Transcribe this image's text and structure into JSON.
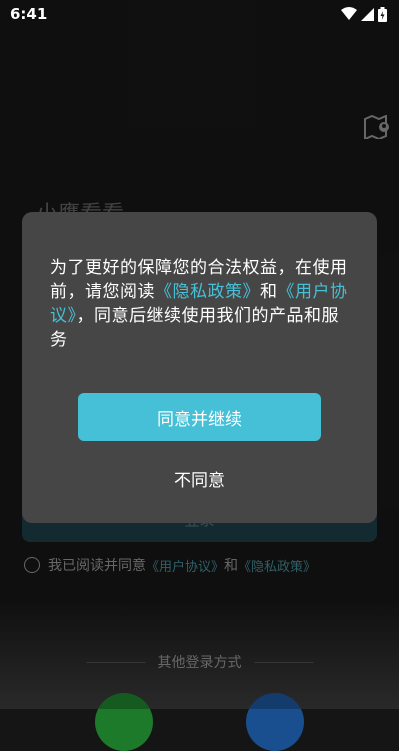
{
  "status_bar": {
    "time": "6:41",
    "icons": [
      "wifi-icon",
      "signal-icon",
      "battery-icon"
    ]
  },
  "background": {
    "app_title": "小鹰看看",
    "login_button_label": "登录",
    "agreement": {
      "prefix": "我已阅读并同意",
      "user_agreement": "《用户协议》",
      "conjunction": "和",
      "privacy_policy": "《隐私政策》"
    },
    "other_login_label": "其他登录方式",
    "map_icon": "map-pin-icon"
  },
  "dialog": {
    "text_part1": "为了更好的保障您的合法权益，在使用前，请您阅读",
    "privacy_link": "《隐私政策》",
    "conjunction": "和",
    "user_agreement_link": "《用户协议》",
    "text_part2": "，同意后继续使用我们的产品和服务",
    "agree_button": "同意并继续",
    "disagree_button": "不同意"
  },
  "colors": {
    "accent": "#45c0d6",
    "dialog_bg": "#464646"
  }
}
